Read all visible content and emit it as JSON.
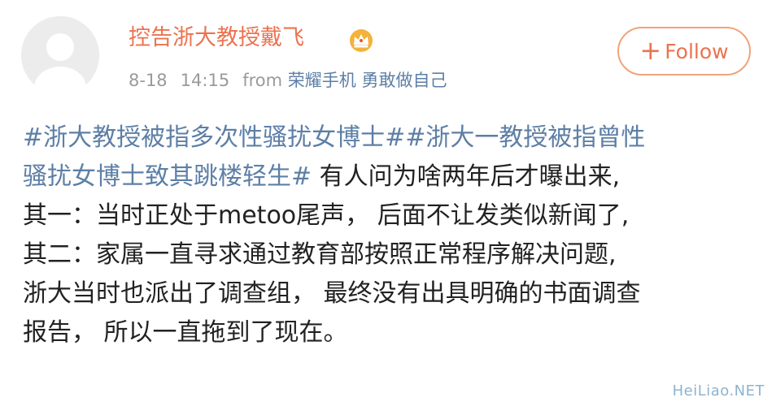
{
  "post": {
    "author": {
      "name": "控告浙大教授戴飞",
      "badge_icon": "crown-badge-icon"
    },
    "meta": {
      "date": "8-18",
      "time": "14:15",
      "from_label": "from",
      "client": "荣耀手机 勇敢做自己"
    },
    "follow": {
      "label": "Follow",
      "icon": "plus-icon"
    },
    "content": {
      "topic1": "#浙大教授被指多次性骚扰女博士#",
      "topic2_part1": "#浙大一教授被指曾性",
      "topic2_part2": "骚扰女博士致其跳楼轻生#",
      "line2_rest": " 有人问为啥两年后才曝出来,",
      "line3": "其一：当时正处于metoo尾声， 后面不让发类似新闻了,",
      "line4": "其二：家属一直寻求通过教育部按照正常程序解决问题,",
      "line5": "浙大当时也派出了调查组， 最终没有出具明确的书面调查",
      "line6": "报告， 所以一直拖到了现在。"
    }
  },
  "watermark": "HeiLiao.NET",
  "colors": {
    "accent": "#eb7350",
    "topic": "#5d7fa6",
    "meta": "#9a9a9a",
    "text": "#222222"
  }
}
